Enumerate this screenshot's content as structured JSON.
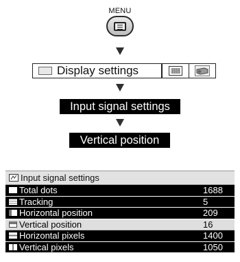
{
  "menu": {
    "label": "MENU",
    "button_icon": "menu-list-icon"
  },
  "flow": {
    "display_settings": {
      "label": "Display settings",
      "icon": "display-icon",
      "tab_icons": [
        "image-tab-icon",
        "projector-tab-icon"
      ]
    },
    "input_signal_settings": "Input signal settings",
    "vertical_position": "Vertical position"
  },
  "panel": {
    "title": "Input signal settings",
    "rows": [
      {
        "name": "Total dots",
        "value": "1688",
        "selected": false
      },
      {
        "name": "Tracking",
        "value": "5",
        "selected": false
      },
      {
        "name": "Horizontal position",
        "value": "209",
        "selected": false
      },
      {
        "name": "Vertical position",
        "value": "16",
        "selected": true
      },
      {
        "name": "Horizontal pixels",
        "value": "1400",
        "selected": false
      },
      {
        "name": "Vertical pixels",
        "value": "1050",
        "selected": false
      }
    ]
  },
  "colors": {
    "highlight": "#dedede",
    "dark_row": "#000000",
    "panel_header": "#e2e2e2"
  }
}
